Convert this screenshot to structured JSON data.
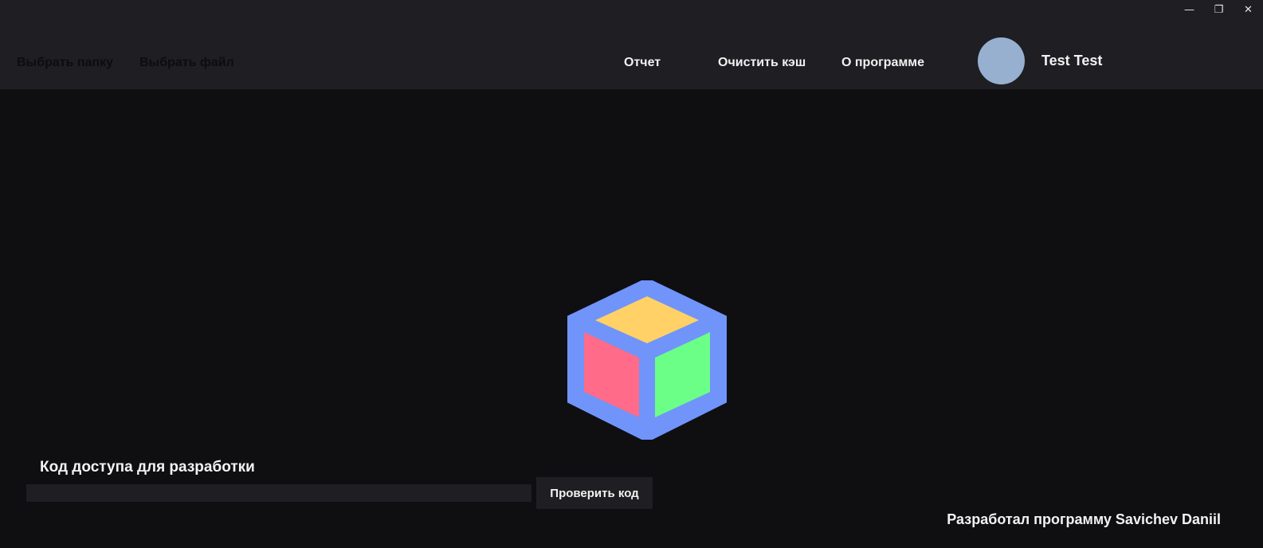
{
  "window_controls": {
    "minimize_glyph": "—",
    "restore_glyph": "❐",
    "close_glyph": "✕"
  },
  "nav": {
    "choose_folder": "Выбрать папку",
    "choose_file": "Выбрать файл",
    "report": "Отчет",
    "clear_cache": "Очистить кэш",
    "about": "О программе"
  },
  "user": {
    "name": "Test Test"
  },
  "logo": {
    "icon": "cube-logo-icon"
  },
  "dev_access": {
    "label": "Код доступа для разработки",
    "value": "",
    "check_button": "Проверить код"
  },
  "footer": {
    "credits": "Разработал программу Savichev Daniil"
  },
  "colors": {
    "background": "#0f0f12",
    "topbar": "#1e1e23",
    "avatar": "#97b0cf",
    "cube_outline": "#7094fa",
    "cube_top": "#ffd166",
    "cube_left": "#ff6b88",
    "cube_right": "#6bff88"
  }
}
